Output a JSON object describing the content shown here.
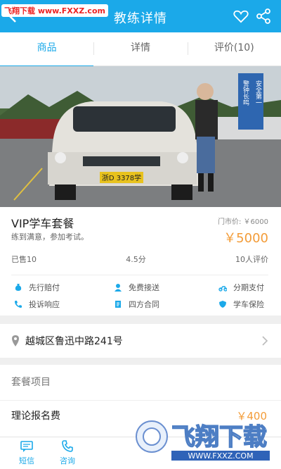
{
  "watermark_top": "飞翔下载 www.FXXZ.com",
  "header": {
    "title": "教练详情"
  },
  "tabs": [
    {
      "label": "商品"
    },
    {
      "label": "详情"
    },
    {
      "label": "评价(10)"
    }
  ],
  "photo": {
    "plate": "浙D 3378学",
    "sign_lines": [
      "安全第一",
      "警钟长鸣"
    ]
  },
  "product": {
    "name": "VIP学车套餐",
    "desc": "练到满意，参加考试。",
    "store_price": "门市价: ￥6000",
    "price": "￥5000"
  },
  "stats": {
    "sold": "已售10",
    "rating": "4.5分",
    "reviews": "10人评价"
  },
  "features": [
    {
      "label": "先行赔付",
      "icon": "money-bag-icon"
    },
    {
      "label": "免费接送",
      "icon": "user-icon"
    },
    {
      "label": "分期支付",
      "icon": "scooter-icon"
    },
    {
      "label": "投诉响应",
      "icon": "phone-icon"
    },
    {
      "label": "四方合同",
      "icon": "document-icon"
    },
    {
      "label": "学车保险",
      "icon": "shield-icon"
    }
  ],
  "address": "越城区鲁迅中路241号",
  "package": {
    "title": "套餐项目",
    "items": [
      {
        "name": "理论报名费",
        "price": "￥400"
      }
    ]
  },
  "bottom": {
    "sms": "短信",
    "consult": "咨询"
  },
  "brand": {
    "name": "飞翔下载",
    "url": "WWW.FXXZ.COM"
  },
  "colors": {
    "primary": "#1ba9e9",
    "price": "#f39c38"
  }
}
